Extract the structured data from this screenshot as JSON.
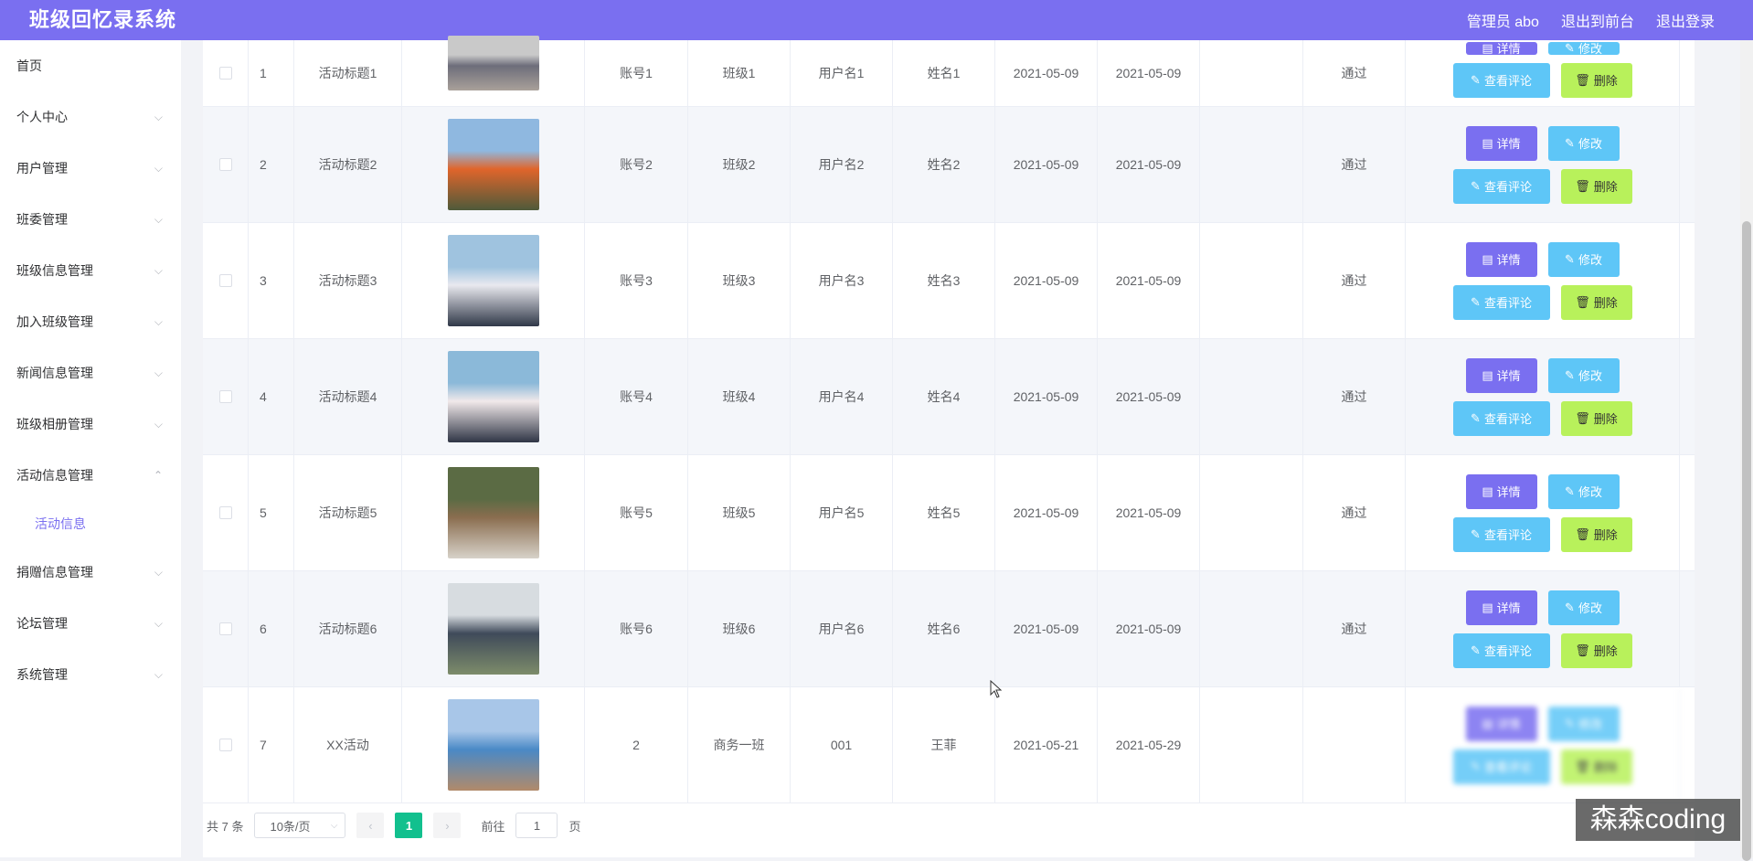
{
  "app": {
    "title": "班级回忆录系统"
  },
  "header": {
    "user": "管理员 abo",
    "front_link": "退出到前台",
    "logout": "退出登录"
  },
  "sidebar": {
    "items": [
      {
        "label": "首页",
        "has_children": false
      },
      {
        "label": "个人中心",
        "has_children": true
      },
      {
        "label": "用户管理",
        "has_children": true
      },
      {
        "label": "班委管理",
        "has_children": true
      },
      {
        "label": "班级信息管理",
        "has_children": true
      },
      {
        "label": "加入班级管理",
        "has_children": true
      },
      {
        "label": "新闻信息管理",
        "has_children": true
      },
      {
        "label": "班级相册管理",
        "has_children": true
      },
      {
        "label": "活动信息管理",
        "has_children": true,
        "expanded": true
      },
      {
        "label": "捐赠信息管理",
        "has_children": true
      },
      {
        "label": "论坛管理",
        "has_children": true
      },
      {
        "label": "系统管理",
        "has_children": true
      }
    ],
    "active_sub": "活动信息"
  },
  "actions": {
    "detail": "详情",
    "edit": "修改",
    "comment": "查看评论",
    "delete": "删除"
  },
  "rows": [
    {
      "idx": "1",
      "title": "活动标题1",
      "account": "账号1",
      "class": "班级1",
      "username": "用户名1",
      "name": "姓名1",
      "d1": "2021-05-09",
      "d2": "2021-05-09",
      "status": "通过"
    },
    {
      "idx": "2",
      "title": "活动标题2",
      "account": "账号2",
      "class": "班级2",
      "username": "用户名2",
      "name": "姓名2",
      "d1": "2021-05-09",
      "d2": "2021-05-09",
      "status": "通过"
    },
    {
      "idx": "3",
      "title": "活动标题3",
      "account": "账号3",
      "class": "班级3",
      "username": "用户名3",
      "name": "姓名3",
      "d1": "2021-05-09",
      "d2": "2021-05-09",
      "status": "通过"
    },
    {
      "idx": "4",
      "title": "活动标题4",
      "account": "账号4",
      "class": "班级4",
      "username": "用户名4",
      "name": "姓名4",
      "d1": "2021-05-09",
      "d2": "2021-05-09",
      "status": "通过"
    },
    {
      "idx": "5",
      "title": "活动标题5",
      "account": "账号5",
      "class": "班级5",
      "username": "用户名5",
      "name": "姓名5",
      "d1": "2021-05-09",
      "d2": "2021-05-09",
      "status": "通过"
    },
    {
      "idx": "6",
      "title": "活动标题6",
      "account": "账号6",
      "class": "班级6",
      "username": "用户名6",
      "name": "姓名6",
      "d1": "2021-05-09",
      "d2": "2021-05-09",
      "status": "通过"
    },
    {
      "idx": "7",
      "title": "XX活动",
      "account": "2",
      "class": "商务一班",
      "username": "001",
      "name": "王菲",
      "d1": "2021-05-21",
      "d2": "2021-05-29",
      "status": ""
    }
  ],
  "pager": {
    "total": "共 7 条",
    "page_size": "10条/页",
    "prev": "‹",
    "current": "1",
    "next": "›",
    "goto_label": "前往",
    "goto_value": "1",
    "page_suffix": "页"
  },
  "watermark": "森森coding",
  "colors": {
    "primary": "#7a6ff0",
    "info": "#5ec6f7",
    "lime": "#b8f15b",
    "active_page": "#12c08e"
  }
}
